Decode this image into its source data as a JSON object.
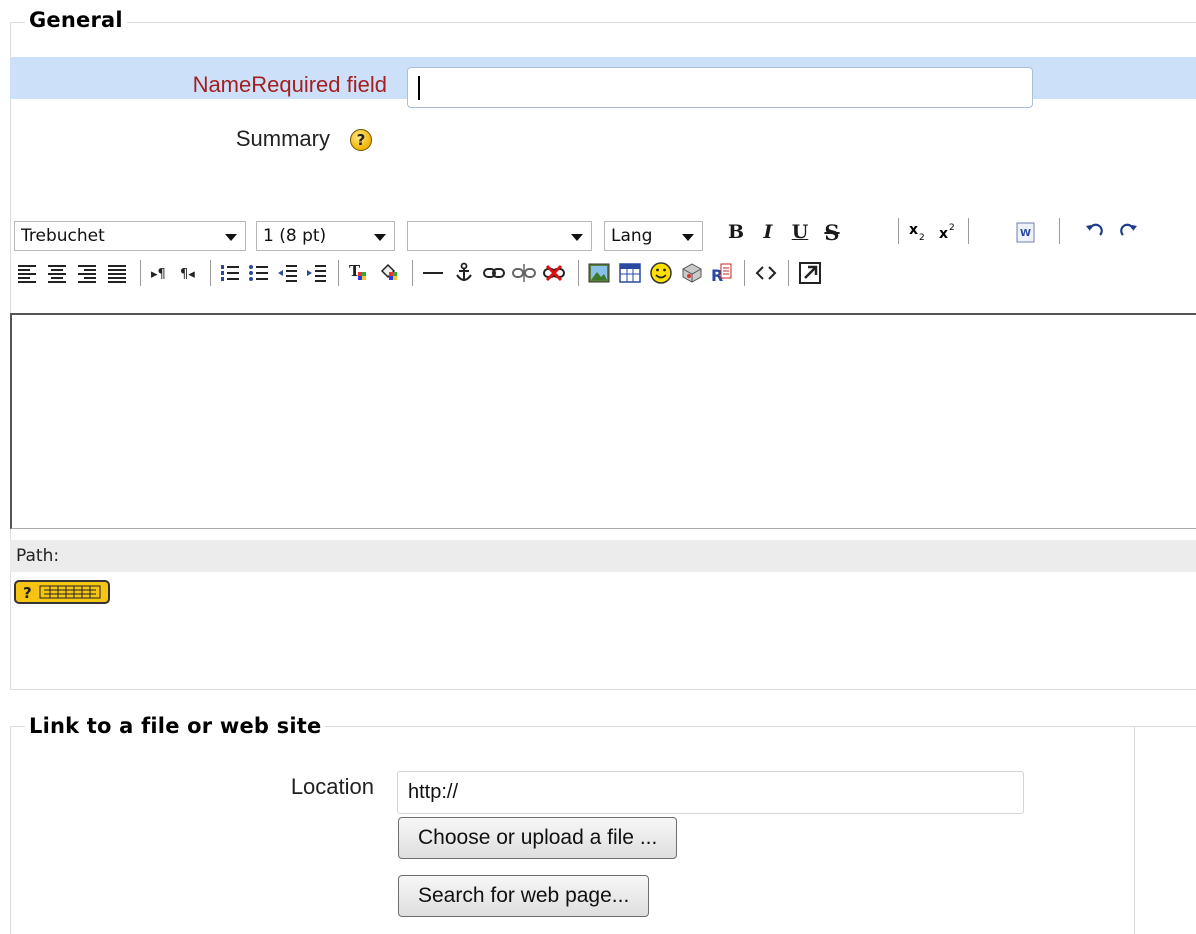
{
  "general": {
    "legend": "General",
    "name_label": "NameRequired field",
    "name_value": "",
    "summary_label": "Summary",
    "help_glyph": "?",
    "editor": {
      "font_family": "Trebuchet",
      "font_size": "1 (8 pt)",
      "format": "",
      "lang": "Lang",
      "bold": "B",
      "italic": "I",
      "underline": "U",
      "strike": "S",
      "path_label": "Path:"
    }
  },
  "link_section": {
    "legend": "Link to a file or web site",
    "location_label": "Location",
    "location_value": "http://",
    "choose_button": "Choose or upload a file ...",
    "search_button": "Search for web page..."
  }
}
